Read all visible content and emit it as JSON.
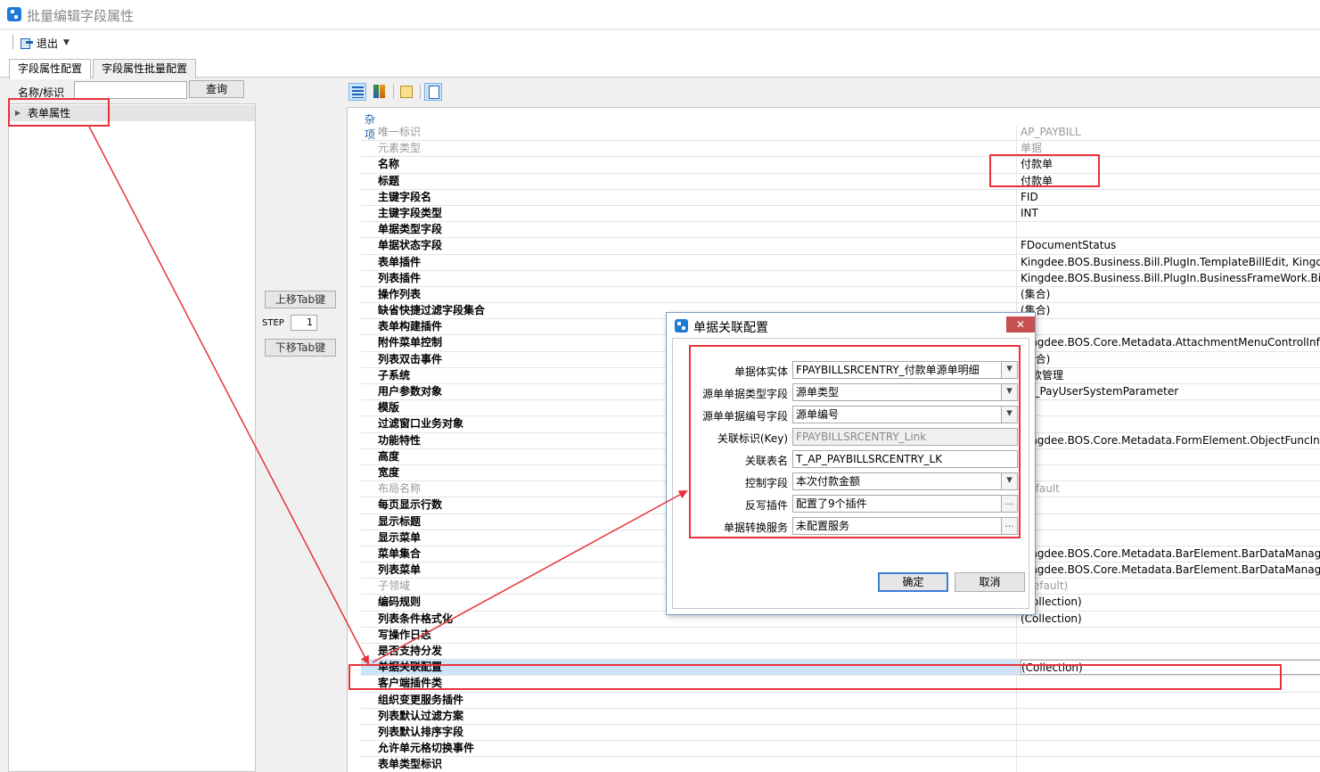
{
  "window": {
    "title": "批量编辑字段属性"
  },
  "toolbar": {
    "exit_label": "退出"
  },
  "tabs": [
    {
      "label": "字段属性配置"
    },
    {
      "label": "字段属性批量配置"
    }
  ],
  "search": {
    "label": "名称/标识",
    "value": "",
    "button": "查询"
  },
  "tree": {
    "root_label": "表单属性"
  },
  "middle": {
    "up_button": "上移Tab键",
    "step_label": "STEP",
    "step_value": "1",
    "down_button": "下移Tab键"
  },
  "grid": {
    "category": "杂项",
    "rows": [
      {
        "name": "唯一标识",
        "value": "AP_PAYBILL",
        "dim": true
      },
      {
        "name": "元素类型",
        "value": "单据",
        "dim": true
      },
      {
        "name": "名称",
        "value": "付款单"
      },
      {
        "name": "标题",
        "value": "付款单"
      },
      {
        "name": "主键字段名",
        "value": "FID"
      },
      {
        "name": "主键字段类型",
        "value": "INT"
      },
      {
        "name": "单据类型字段",
        "value": ""
      },
      {
        "name": "单据状态字段",
        "value": "FDocumentStatus"
      },
      {
        "name": "表单插件",
        "value": "Kingdee.BOS.Business.Bill.PlugIn.TemplateBillEdit, Kingdee.BO"
      },
      {
        "name": "列表插件",
        "value": "Kingdee.BOS.Business.Bill.PlugIn.BusinessFrameWork.BillList, K"
      },
      {
        "name": "操作列表",
        "value": "(集合)"
      },
      {
        "name": "缺省快捷过滤字段集合",
        "value": "(集合)"
      },
      {
        "name": "表单构建插件",
        "value": ""
      },
      {
        "name": "附件菜单控制",
        "value": "Kingdee.BOS.Core.Metadata.AttachmentMenuControlInfo"
      },
      {
        "name": "列表双击事件",
        "value": "(集合)"
      },
      {
        "name": "子系统",
        "value": "付款管理"
      },
      {
        "name": "用户参数对象",
        "value": "AP_PayUserSystemParameter"
      },
      {
        "name": "模版",
        "value": ""
      },
      {
        "name": "过滤窗口业务对象",
        "value": ""
      },
      {
        "name": "功能特性",
        "value": "Kingdee.BOS.Core.Metadata.FormElement.ObjectFuncInterface"
      },
      {
        "name": "高度",
        "value": ""
      },
      {
        "name": "宽度",
        "value": ""
      },
      {
        "name": "布局名称",
        "value": "Default",
        "dim": true
      },
      {
        "name": "每页显示行数",
        "value": ""
      },
      {
        "name": "显示标题",
        "value": ""
      },
      {
        "name": "显示菜单",
        "value": ""
      },
      {
        "name": "菜单集合",
        "value": "Kingdee.BOS.Core.Metadata.BarElement.BarDataManager"
      },
      {
        "name": "列表菜单",
        "value": "Kingdee.BOS.Core.Metadata.BarElement.BarDataManager"
      },
      {
        "name": "子领域",
        "value": "(Default)",
        "dim": true
      },
      {
        "name": "编码规则",
        "value": "(Collection)"
      },
      {
        "name": "列表条件格式化",
        "value": "(Collection)"
      },
      {
        "name": "写操作日志",
        "value": ""
      },
      {
        "name": "是否支持分发",
        "value": ""
      },
      {
        "name": "单据关联配置",
        "value": "(Collection)",
        "selected": true
      },
      {
        "name": "客户端插件类",
        "value": ""
      },
      {
        "name": "组织变更服务插件",
        "value": ""
      },
      {
        "name": "列表默认过滤方案",
        "value": ""
      },
      {
        "name": "列表默认排序字段",
        "value": ""
      },
      {
        "name": "允许单元格切换事件",
        "value": ""
      },
      {
        "name": "表单类型标识",
        "value": ""
      }
    ]
  },
  "dialog": {
    "title": "单据关联配置",
    "close": "✕",
    "fields": [
      {
        "label": "单据体实体",
        "value": "FPAYBILLSRCENTRY_付款单源单明细",
        "control": "dropdown"
      },
      {
        "label": "源单单据类型字段",
        "value": "源单类型",
        "control": "dropdown"
      },
      {
        "label": "源单单据编号字段",
        "value": "源单编号",
        "control": "dropdown"
      },
      {
        "label": "关联标识(Key)",
        "value": "FPAYBILLSRCENTRY_Link",
        "control": "readonly"
      },
      {
        "label": "关联表名",
        "value": "T_AP_PAYBILLSRCENTRY_LK",
        "control": "text"
      },
      {
        "label": "控制字段",
        "value": "本次付款金额",
        "control": "dropdown"
      },
      {
        "label": "反写插件",
        "value": "配置了9个插件",
        "control": "ellipsis"
      },
      {
        "label": "单据转换服务",
        "value": "未配置服务",
        "control": "ellipsis"
      }
    ],
    "ok": "确定",
    "cancel": "取消"
  },
  "annotation_color": "#e8323a"
}
